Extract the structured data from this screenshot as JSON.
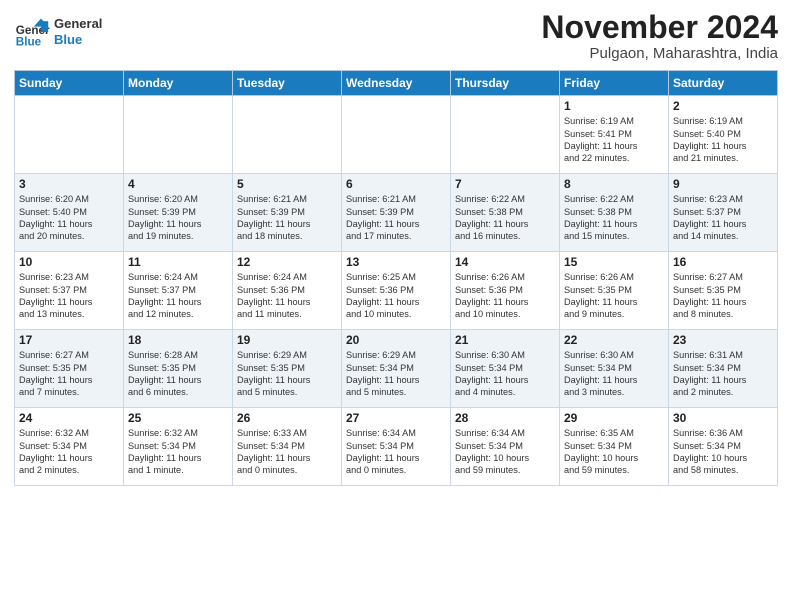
{
  "logo": {
    "line1": "General",
    "line2": "Blue"
  },
  "title": "November 2024",
  "location": "Pulgaon, Maharashtra, India",
  "weekdays": [
    "Sunday",
    "Monday",
    "Tuesday",
    "Wednesday",
    "Thursday",
    "Friday",
    "Saturday"
  ],
  "weeks": [
    [
      {
        "day": "",
        "info": ""
      },
      {
        "day": "",
        "info": ""
      },
      {
        "day": "",
        "info": ""
      },
      {
        "day": "",
        "info": ""
      },
      {
        "day": "",
        "info": ""
      },
      {
        "day": "1",
        "info": "Sunrise: 6:19 AM\nSunset: 5:41 PM\nDaylight: 11 hours\nand 22 minutes."
      },
      {
        "day": "2",
        "info": "Sunrise: 6:19 AM\nSunset: 5:40 PM\nDaylight: 11 hours\nand 21 minutes."
      }
    ],
    [
      {
        "day": "3",
        "info": "Sunrise: 6:20 AM\nSunset: 5:40 PM\nDaylight: 11 hours\nand 20 minutes."
      },
      {
        "day": "4",
        "info": "Sunrise: 6:20 AM\nSunset: 5:39 PM\nDaylight: 11 hours\nand 19 minutes."
      },
      {
        "day": "5",
        "info": "Sunrise: 6:21 AM\nSunset: 5:39 PM\nDaylight: 11 hours\nand 18 minutes."
      },
      {
        "day": "6",
        "info": "Sunrise: 6:21 AM\nSunset: 5:39 PM\nDaylight: 11 hours\nand 17 minutes."
      },
      {
        "day": "7",
        "info": "Sunrise: 6:22 AM\nSunset: 5:38 PM\nDaylight: 11 hours\nand 16 minutes."
      },
      {
        "day": "8",
        "info": "Sunrise: 6:22 AM\nSunset: 5:38 PM\nDaylight: 11 hours\nand 15 minutes."
      },
      {
        "day": "9",
        "info": "Sunrise: 6:23 AM\nSunset: 5:37 PM\nDaylight: 11 hours\nand 14 minutes."
      }
    ],
    [
      {
        "day": "10",
        "info": "Sunrise: 6:23 AM\nSunset: 5:37 PM\nDaylight: 11 hours\nand 13 minutes."
      },
      {
        "day": "11",
        "info": "Sunrise: 6:24 AM\nSunset: 5:37 PM\nDaylight: 11 hours\nand 12 minutes."
      },
      {
        "day": "12",
        "info": "Sunrise: 6:24 AM\nSunset: 5:36 PM\nDaylight: 11 hours\nand 11 minutes."
      },
      {
        "day": "13",
        "info": "Sunrise: 6:25 AM\nSunset: 5:36 PM\nDaylight: 11 hours\nand 10 minutes."
      },
      {
        "day": "14",
        "info": "Sunrise: 6:26 AM\nSunset: 5:36 PM\nDaylight: 11 hours\nand 10 minutes."
      },
      {
        "day": "15",
        "info": "Sunrise: 6:26 AM\nSunset: 5:35 PM\nDaylight: 11 hours\nand 9 minutes."
      },
      {
        "day": "16",
        "info": "Sunrise: 6:27 AM\nSunset: 5:35 PM\nDaylight: 11 hours\nand 8 minutes."
      }
    ],
    [
      {
        "day": "17",
        "info": "Sunrise: 6:27 AM\nSunset: 5:35 PM\nDaylight: 11 hours\nand 7 minutes."
      },
      {
        "day": "18",
        "info": "Sunrise: 6:28 AM\nSunset: 5:35 PM\nDaylight: 11 hours\nand 6 minutes."
      },
      {
        "day": "19",
        "info": "Sunrise: 6:29 AM\nSunset: 5:35 PM\nDaylight: 11 hours\nand 5 minutes."
      },
      {
        "day": "20",
        "info": "Sunrise: 6:29 AM\nSunset: 5:34 PM\nDaylight: 11 hours\nand 5 minutes."
      },
      {
        "day": "21",
        "info": "Sunrise: 6:30 AM\nSunset: 5:34 PM\nDaylight: 11 hours\nand 4 minutes."
      },
      {
        "day": "22",
        "info": "Sunrise: 6:30 AM\nSunset: 5:34 PM\nDaylight: 11 hours\nand 3 minutes."
      },
      {
        "day": "23",
        "info": "Sunrise: 6:31 AM\nSunset: 5:34 PM\nDaylight: 11 hours\nand 2 minutes."
      }
    ],
    [
      {
        "day": "24",
        "info": "Sunrise: 6:32 AM\nSunset: 5:34 PM\nDaylight: 11 hours\nand 2 minutes."
      },
      {
        "day": "25",
        "info": "Sunrise: 6:32 AM\nSunset: 5:34 PM\nDaylight: 11 hours\nand 1 minute."
      },
      {
        "day": "26",
        "info": "Sunrise: 6:33 AM\nSunset: 5:34 PM\nDaylight: 11 hours\nand 0 minutes."
      },
      {
        "day": "27",
        "info": "Sunrise: 6:34 AM\nSunset: 5:34 PM\nDaylight: 11 hours\nand 0 minutes."
      },
      {
        "day": "28",
        "info": "Sunrise: 6:34 AM\nSunset: 5:34 PM\nDaylight: 10 hours\nand 59 minutes."
      },
      {
        "day": "29",
        "info": "Sunrise: 6:35 AM\nSunset: 5:34 PM\nDaylight: 10 hours\nand 59 minutes."
      },
      {
        "day": "30",
        "info": "Sunrise: 6:36 AM\nSunset: 5:34 PM\nDaylight: 10 hours\nand 58 minutes."
      }
    ]
  ]
}
